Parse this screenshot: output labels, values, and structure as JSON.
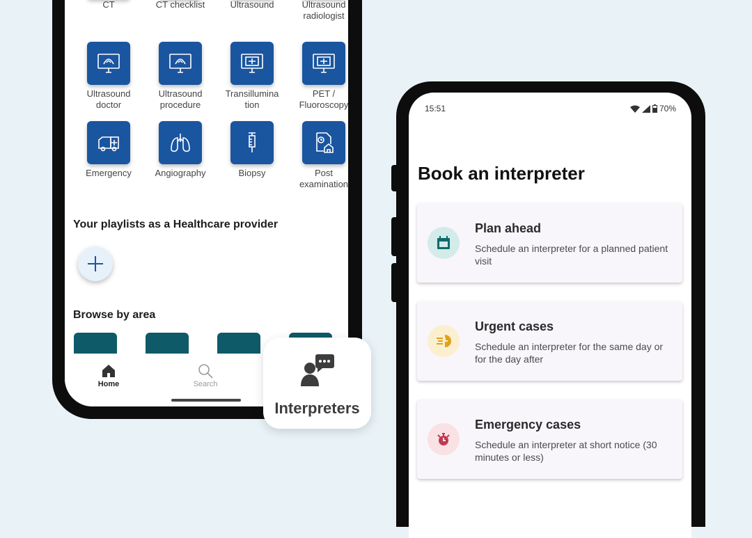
{
  "home_screen": {
    "tiles_top_row": [
      "CT",
      "CT checklist",
      "Ultrasound",
      "Ultrasound\nradiologist"
    ],
    "tiles_row2": [
      "Ultrasound\ndoctor",
      "Ultrasound\nprocedure",
      "Transillumina\ntion",
      "PET /\nFluoroscopy"
    ],
    "tiles_row3": [
      "Emergency",
      "Angiography",
      "Biopsy",
      "Post\nexamination"
    ],
    "playlists_title": "Your playlists as a Healthcare provider",
    "browse_title": "Browse by area",
    "nav": {
      "home": "Home",
      "search": "Search"
    }
  },
  "badge": {
    "label": "Interpreters",
    "icon": "interpreter-chat-icon"
  },
  "booking_screen": {
    "status": {
      "time": "15:51",
      "battery": "70%"
    },
    "title": "Book an interpreter",
    "cards": [
      {
        "title": "Plan ahead",
        "desc": "Schedule an interpreter for a planned patient visit",
        "icon": "calendar-icon",
        "color": "#0e6b6b",
        "bg": "#d3ebe9"
      },
      {
        "title": "Urgent cases",
        "desc": "Schedule an interpreter for the same day or for the day after",
        "icon": "speed-clock-icon",
        "color": "#e0a21a",
        "bg": "#fbefcf"
      },
      {
        "title": "Emergency cases",
        "desc": "Schedule an interpreter at short notice (30 minutes or less)",
        "icon": "alarm-icon",
        "color": "#c0394e",
        "bg": "#f9e1e4"
      }
    ]
  }
}
